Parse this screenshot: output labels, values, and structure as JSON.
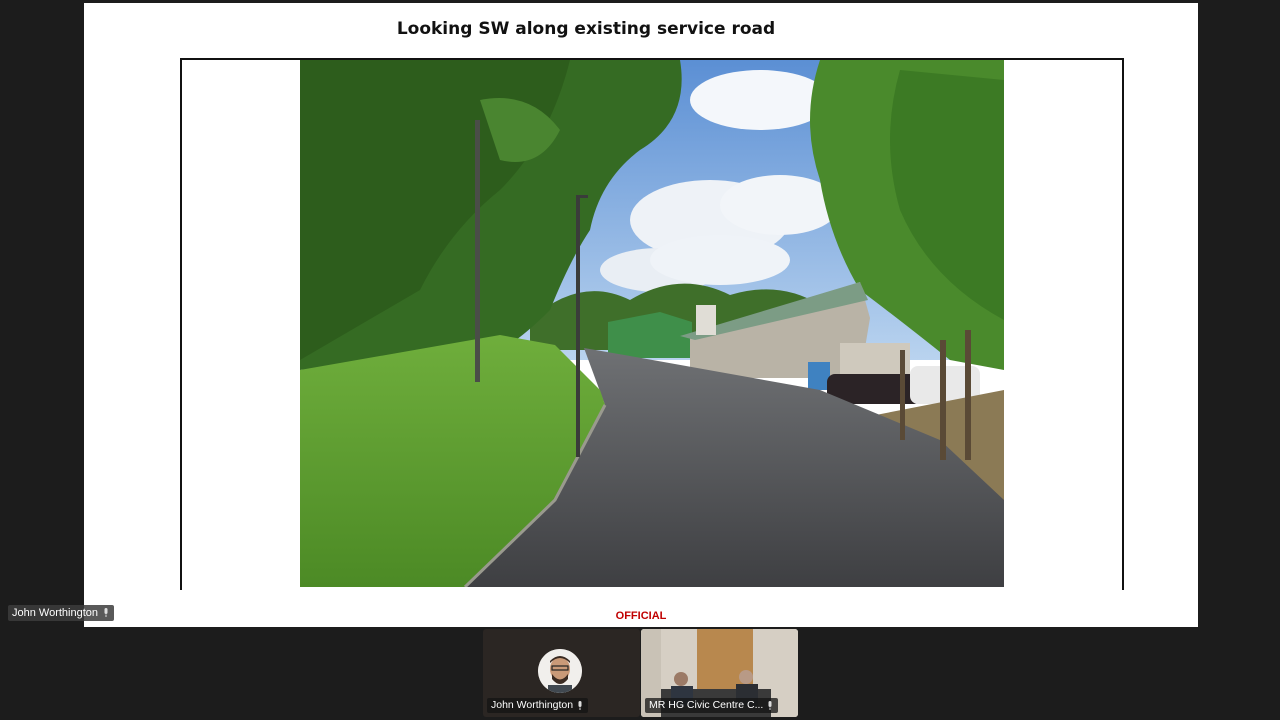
{
  "slide": {
    "title": "Looking SW along existing service road",
    "footer_label": "OFFICIAL",
    "colors": {
      "footer": "#c00000",
      "title": "#111111"
    }
  },
  "active_speaker": {
    "name": "John Worthington",
    "icon": "mic-icon"
  },
  "participants": [
    {
      "name": "John Worthington",
      "icon": "mic-icon"
    },
    {
      "name": "MR HG Civic Centre C...",
      "icon": "mic-icon"
    }
  ]
}
